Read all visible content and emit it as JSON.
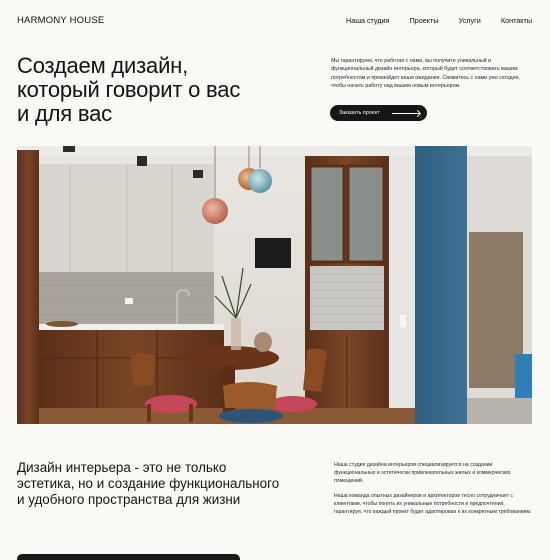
{
  "header": {
    "logo": "HARMONY HOUSE",
    "nav": [
      "Наша студия",
      "Проекты",
      "Услуги",
      "Контакты"
    ]
  },
  "hero": {
    "title_lines": [
      "Создаем дизайн,",
      "который говорит о вас",
      "и для вас"
    ],
    "text": "Мы гарантируем, что работая с нами, вы получите уникальный и функциональный дизайн интерьера, который будет соответствовать вашим потребностям и превзойдет ваши ожидания. Свяжитесь с нами уже сегодня, чтобы начать работу над вашим новым интерьером.",
    "button_label": "Заказать проект"
  },
  "photo": {
    "alt": "interior-photo"
  },
  "about": {
    "title": "Дизайн интерьера - это не только эстетика, но и создание функционального и удобного пространства для жизни",
    "paragraphs": [
      "Наша студия дизайна интерьеров специализируется на создании функциональных и эстетически привлекательных жилых и коммерческих помещений.",
      "Наша команда опытных дизайнеров и архитекторов тесно сотрудничает с клиентами, чтобы понять их уникальные потребности и предпочтения, гарантируя, что каждый проект будет адаптирован к их конкретным требованиям."
    ]
  },
  "colors": {
    "background": "#fbf9f6",
    "button": "#161616",
    "accent_wall": "#3b6b8a"
  }
}
